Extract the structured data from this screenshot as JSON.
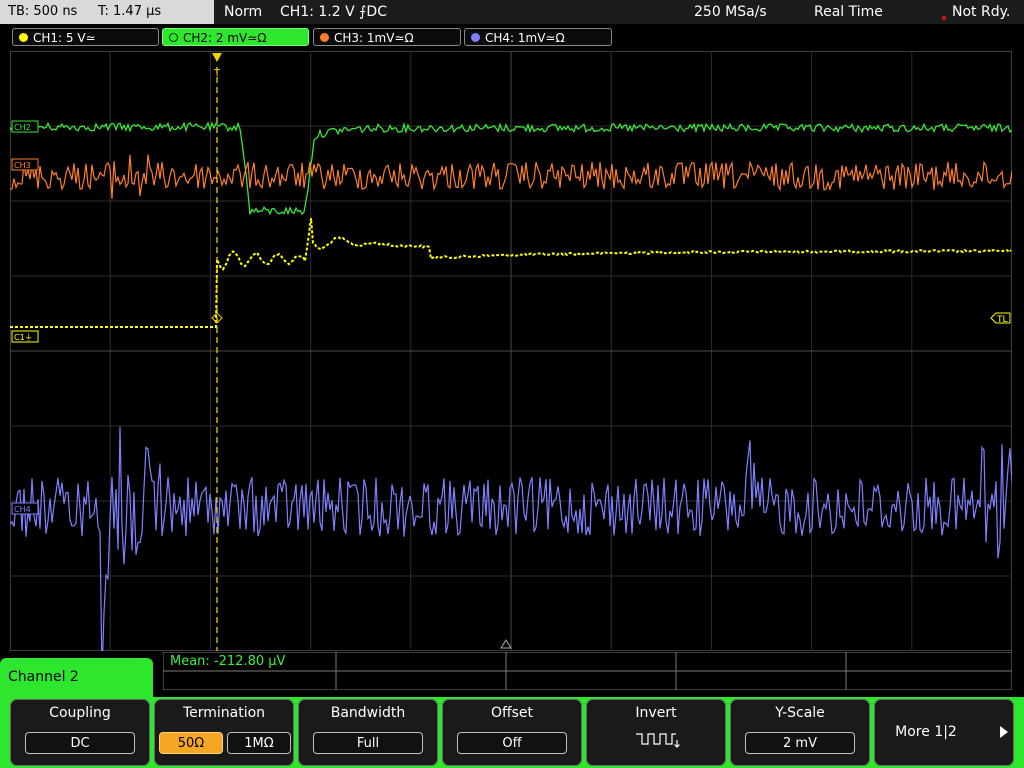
{
  "status_bar": {
    "timebase": "TB: 500 ns",
    "trigger_time": "T: 1.47 µs",
    "mode": "Norm",
    "trigger": "CH1: 1.2 V ⨍DC",
    "sample_rate": "250 MSa/s",
    "acq_mode": "Real Time",
    "status": "Not Rdy."
  },
  "channels": [
    {
      "label": "CH1: 5 V≃",
      "color": "#ffff00",
      "active": false
    },
    {
      "label": "CH2: 2 mV≃Ω",
      "color": "#39e639",
      "active": true
    },
    {
      "label": "CH3: 1mV≃Ω",
      "color": "#ff7f2a",
      "active": false
    },
    {
      "label": "CH4: 1mV≃Ω",
      "color": "#8080ff",
      "active": false
    }
  ],
  "markers": {
    "trigger_top": "T",
    "trigger_level": "TL",
    "ch1_ref": "C1⏚",
    "ch2_ref": "CH2",
    "ch3_ref": "CH3",
    "ch4_ref": "CH4"
  },
  "measurement": {
    "mean": "Mean: -212.80 µV"
  },
  "menu": {
    "title": "Channel 2",
    "coupling": {
      "title": "Coupling",
      "value": "DC"
    },
    "termination": {
      "title": "Termination",
      "opt1": "50Ω",
      "opt2": "1MΩ"
    },
    "bandwidth": {
      "title": "Bandwidth",
      "value": "Full"
    },
    "offset": {
      "title": "Offset",
      "value": "Off"
    },
    "invert": {
      "title": "Invert"
    },
    "yscale": {
      "title": "Y-Scale",
      "value": "2 mV"
    },
    "more": {
      "label": "More 1|2"
    }
  },
  "colors": {
    "ch1": "#ffff00",
    "ch2": "#39e639",
    "ch3": "#ff7f2a",
    "ch4": "#8080ff",
    "grid": "#3a3a3a",
    "trigger": "#f0d000",
    "accent": "#2ee62e"
  }
}
